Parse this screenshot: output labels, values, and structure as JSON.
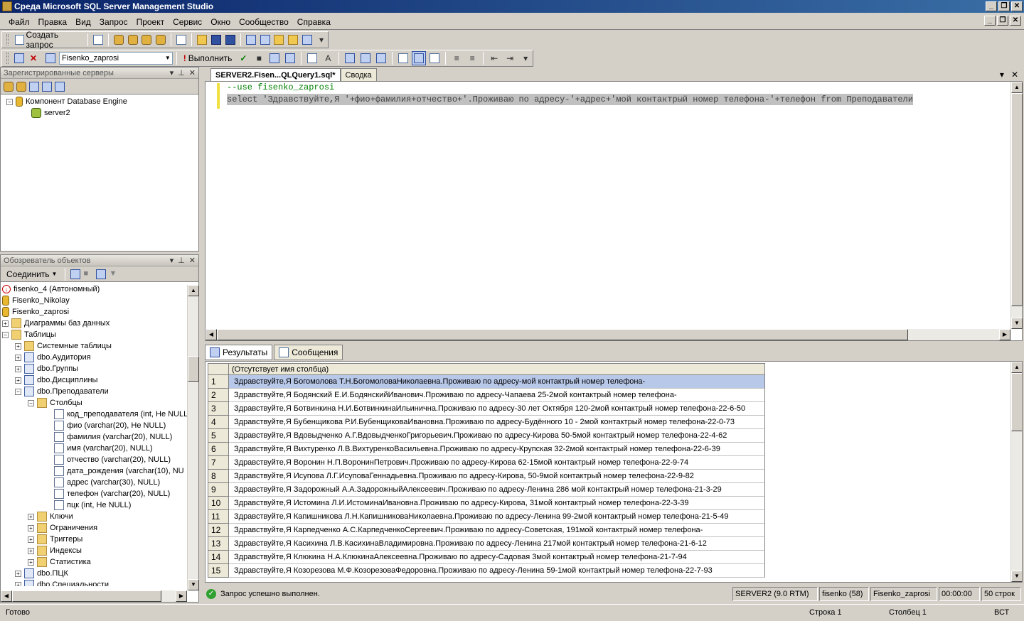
{
  "window": {
    "title": "Среда Microsoft SQL Server Management Studio"
  },
  "menu": [
    "Файл",
    "Правка",
    "Вид",
    "Запрос",
    "Проект",
    "Сервис",
    "Окно",
    "Сообщество",
    "Справка"
  ],
  "toolbar1": {
    "new_query": "Создать запрос"
  },
  "toolbar2": {
    "database": "Fisenko_zaprosi",
    "execute": "Выполнить"
  },
  "registered_servers": {
    "title": "Зарегистрированные серверы",
    "tree": [
      {
        "label": "Компонент Database Engine"
      },
      {
        "label": "server2"
      }
    ]
  },
  "object_explorer": {
    "title": "Обозреватель объектов",
    "connect": "Соединить",
    "tree": [
      {
        "label": "fisenko_4 (Автономный)"
      },
      {
        "label": "Fisenko_Nikolay"
      },
      {
        "label": "Fisenko_zaprosi"
      },
      {
        "label": "Диаграммы баз данных"
      },
      {
        "label": "Таблицы"
      },
      {
        "label": "Системные таблицы"
      },
      {
        "label": "dbo.Аудитория"
      },
      {
        "label": "dbo.Группы"
      },
      {
        "label": "dbo.Дисциплины"
      },
      {
        "label": "dbo.Преподаватели"
      },
      {
        "label": "Столбцы"
      },
      {
        "label": "код_преподавателя (int, Не NULL"
      },
      {
        "label": "фио (varchar(20), Не NULL)"
      },
      {
        "label": "фамилия (varchar(20), NULL)"
      },
      {
        "label": "имя (varchar(20), NULL)"
      },
      {
        "label": "отчество (varchar(20), NULL)"
      },
      {
        "label": "дата_рождения (varchar(10), NU"
      },
      {
        "label": "адрес (varchar(30), NULL)"
      },
      {
        "label": "телефон (varchar(20), NULL)"
      },
      {
        "label": "пцк (int, Не NULL)"
      },
      {
        "label": "Ключи"
      },
      {
        "label": "Ограничения"
      },
      {
        "label": "Триггеры"
      },
      {
        "label": "Индексы"
      },
      {
        "label": "Статистика"
      },
      {
        "label": "dbo.ПЦК"
      },
      {
        "label": "dbo.Специальности"
      }
    ]
  },
  "doc_tabs": [
    "SERVER2.Fisen...QLQuery1.sql*",
    "Сводка"
  ],
  "editor": {
    "lines": [
      "--use fisenko_zaprosi",
      "select 'Здравствуйте,Я '+фио+фамилия+отчество+'.Проживаю по адресу-'+адрес+'мой контактрый номер телефона-'+телефон  from Преподаватели"
    ]
  },
  "result_tabs": [
    "Результаты",
    "Сообщения"
  ],
  "results": {
    "column": "(Отсутствует имя столбца)",
    "rows": [
      "Здравствуйте,Я Богомолова Т.Н.БогомоловаНиколаевна.Проживаю по адресу-мой контактрый номер телефона-",
      "Здравствуйте,Я Бодянский Е.И.БодянскийИванович.Проживаю по адресу-Чапаева  25-2мой контактрый номер телефона-",
      "Здравствуйте,Я Ботвинкина Н.И.БотвинкинаИльинична.Проживаю по адресу-30 лет Октября 120-2мой контактрый номер телефона-22-6-50",
      "Здравствуйте,Я Бубенщикова Р.И.БубенщиковаИвановна.Проживаю по адресу-Будённого 10 - 2мой контактрый номер телефона-22-0-73",
      "Здравствуйте,Я Вдовыдченко А.Г.ВдовыдченкоГригорьевич.Проживаю по адресу-Кирова 50-5мой контактрый номер телефона-22-4-62",
      "Здравствуйте,Я Вихтуренко Л.В.ВихтуренкоВасильевна.Проживаю по адресу-Крупская 32-2мой контактрый номер телефона-22-6-39",
      "Здравствуйте,Я Воронин Н.П.ВоронинПетрович.Проживаю по адресу-Кирова 62-15мой контактрый номер телефона-22-9-74",
      "Здравствуйте,Я Исупова Л.Г.ИсуповаГеннадьевна.Проживаю по адресу-Кирова, 50-9мой контактрый номер телефона-22-9-82",
      "Здравствуйте,Я Задорожный А.А.ЗадорожныйАлексеевич.Проживаю по адресу-Ленина 286 мой контактрый номер телефона-21-3-29",
      "Здравствуйте,Я Истомина Л.И.ИстоминаИвановна.Проживаю по адресу-Кирова, 31мой контактрый номер телефона-22-3-39",
      "Здравствуйте,Я Капишникова Л.Н.КапишниковаНиколаевна.Проживаю по адресу-Ленина 99-2мой контактрый номер телефона-21-5-49",
      "Здравствуйте,Я Карпедченко А.С.КарпедченкоСергеевич.Проживаю по адресу-Советская, 191мой контактрый номер телефона-",
      "Здравствуйте,Я Касихина Л.В.КасихинаВладимировна.Проживаю по адресу-Ленина 217мой контактрый номер телефона-21-6-12",
      "Здравствуйте,Я Клюкина Н.А.КлюкинаАлексеевна.Проживаю по адресу-Садовая 3мой контактрый номер телефона-21-7-94",
      "Здравствуйте,Я Козорезова М.Ф.КозорезоваФедоровна.Проживаю по адресу-Ленина 59-1мой контактрый номер телефона-22-7-93"
    ]
  },
  "query_status": {
    "message": "Запрос успешно выполнен.",
    "server": "SERVER2 (9.0 RTM)",
    "user": "fisenko (58)",
    "database": "Fisenko_zaprosi",
    "time": "00:00:00",
    "rows": "50 строк"
  },
  "status": {
    "ready": "Готово",
    "line": "Строка 1",
    "col": "Столбец 1",
    "mode": "ВСТ"
  }
}
